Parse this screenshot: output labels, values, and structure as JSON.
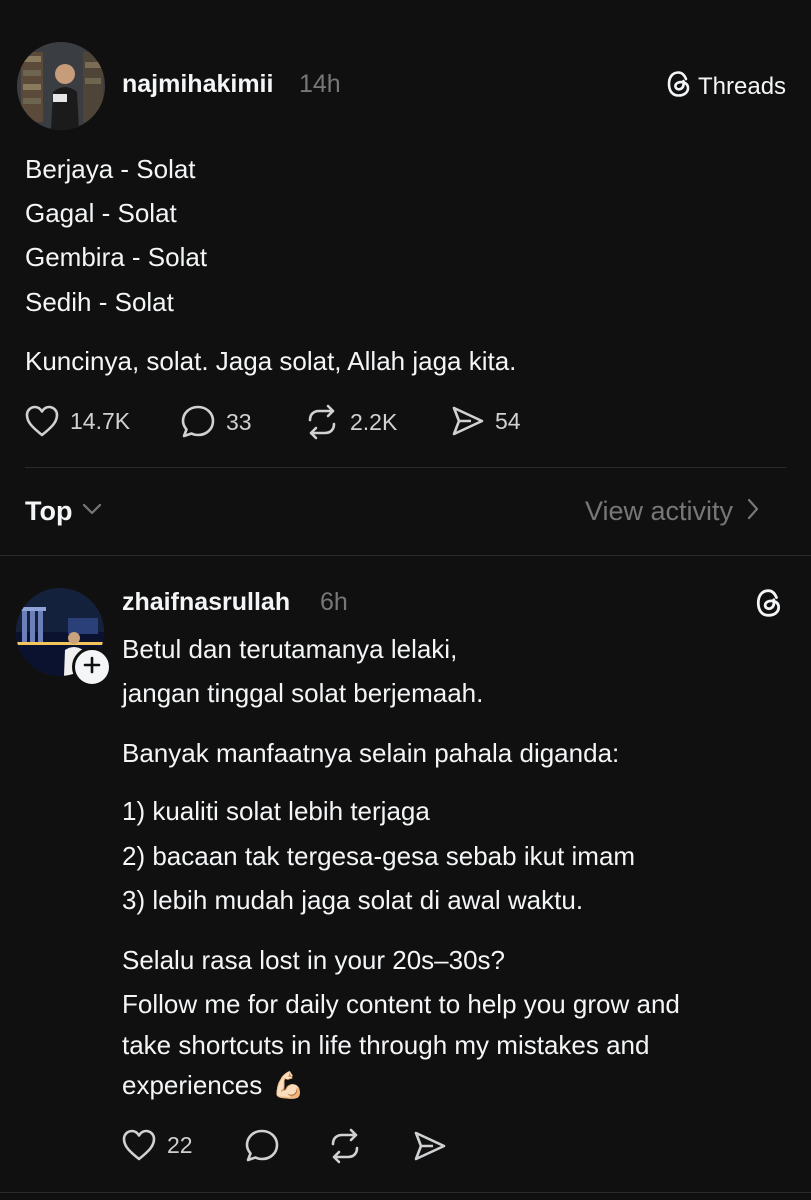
{
  "post": {
    "username": "najmihakimii",
    "time": "14h",
    "threads_label": "Threads",
    "lines": [
      "Berjaya - Solat",
      "Gagal - Solat",
      "Gembira - Solat",
      "Sedih - Solat"
    ],
    "closing": "Kuncinya, solat. Jaga solat, Allah jaga kita.",
    "stats": {
      "likes": "14.7K",
      "replies": "33",
      "reposts": "2.2K",
      "shares": "54"
    }
  },
  "sort_bar": {
    "label": "Top",
    "view_activity": "View activity"
  },
  "reply": {
    "username": "zhaifnasrullah",
    "time": "6h",
    "para1": [
      "Betul dan terutamanya lelaki,",
      "jangan tinggal solat berjemaah."
    ],
    "para2": "Banyak manfaatnya selain pahala diganda:",
    "list": [
      "1) kualiti solat lebih terjaga",
      "2) bacaan tak tergesa-gesa sebab ikut imam",
      "3) lebih mudah jaga solat di awal waktu."
    ],
    "para3": [
      "Selalu rasa lost in your 20s–30s?",
      "Follow me for daily content to help you grow and",
      "take shortcuts in life through my mistakes and",
      "experiences"
    ],
    "emoji": "💪🏻",
    "stats": {
      "likes": "22"
    }
  },
  "colors": {
    "background": "#101010",
    "text": "#f3f5f7",
    "muted": "#777777",
    "divider": "#2b2b2b"
  },
  "icons": [
    "threads-logo-icon",
    "heart-icon",
    "comment-icon",
    "repost-icon",
    "share-icon",
    "chevron-down-icon",
    "chevron-right-icon",
    "follow-plus-icon"
  ]
}
